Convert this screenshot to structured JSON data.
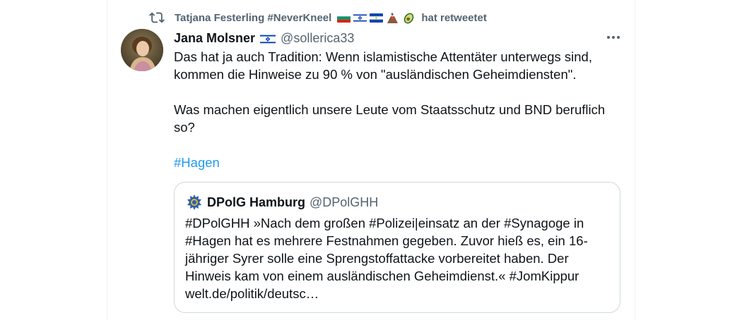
{
  "retweet": {
    "icon": "retweet-icon",
    "user": "Tatjana Festerling #NeverKneel",
    "suffix": "hat retweetet",
    "emojis": [
      "bulgaria-flag",
      "israel-flag",
      "el-salvador-flag",
      "volcano-emoji",
      "avocado-emoji"
    ]
  },
  "tweet": {
    "name": "Jana Molsner",
    "name_emoji": "israel-flag",
    "handle": "@sollerica33",
    "paragraph1": "Das hat ja auch Tradition: Wenn islamistische Attentäter unterwegs sind, kommen die Hinweise zu 90 % von \"ausländischen Geheimdiensten\".",
    "paragraph2": "Was machen eigentlich unsere Leute vom Staatsschutz und BND beruflich so?",
    "hashtag": "#Hagen"
  },
  "quote": {
    "name": "DPolG Hamburg",
    "handle": "@DPolGHH",
    "text": "#DPolGHH »Nach dem großen #Polizei|einsatz an der #Synagoge in #Hagen hat es mehrere Festnahmen gegeben. Zuvor hieß es, ein 16-jähriger Syrer solle eine Sprengstoffattacke vorbereitet haben. Der Hinweis kam von einem ausländischen Geheimdienst.« #JomKippur welt.de/politik/deutsc…"
  },
  "colors": {
    "text": "#0f1419",
    "secondary": "#536471",
    "link": "#1d9bf0",
    "border": "#cfd9de"
  }
}
